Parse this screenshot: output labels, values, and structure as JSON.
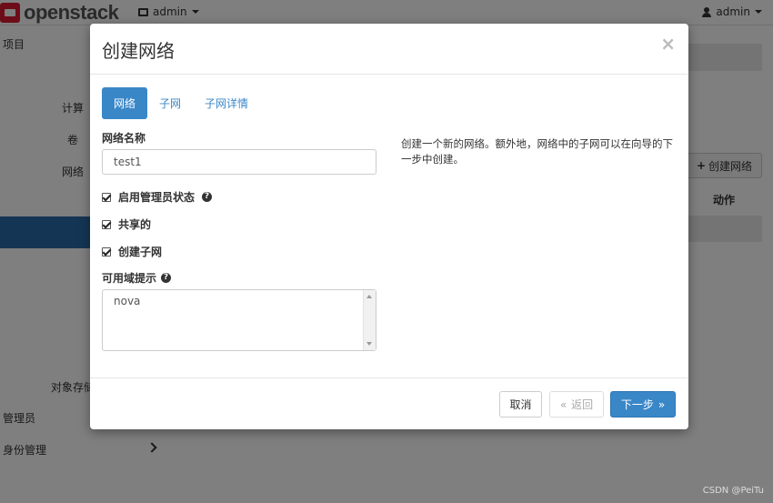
{
  "topbar": {
    "logo_text": "openstack",
    "project_label": "admin",
    "user_label": "admin"
  },
  "sidenav": {
    "project": "项目",
    "compute": "计算",
    "volume": "卷",
    "network": "网络",
    "object_store": "对象存储",
    "admin": "管理员",
    "identity": "身份管理"
  },
  "background": {
    "create_network_button": "创建网络",
    "actions_header": "动作"
  },
  "modal": {
    "title": "创建网络",
    "close_glyph": "×",
    "tabs": [
      {
        "label": "网络",
        "active": true
      },
      {
        "label": "子网",
        "active": false
      },
      {
        "label": "子网详情",
        "active": false
      }
    ],
    "network_name_label": "网络名称",
    "network_name_value": "test1",
    "checkboxes": [
      {
        "label": "启用管理员状态",
        "checked": true,
        "help": true
      },
      {
        "label": "共享的",
        "checked": true,
        "help": false
      },
      {
        "label": "创建子网",
        "checked": true,
        "help": false
      }
    ],
    "az_hint_label": "可用域提示",
    "az_hint_value": "nova",
    "help_text": "创建一个新的网络。额外地，网络中的子网可以在向导的下一步中创建。",
    "footer": {
      "cancel": "取消",
      "back": "返回",
      "back_glyph": "«",
      "next": "下一步",
      "next_glyph": "»"
    }
  },
  "watermark": "CSDN @PeiTu",
  "colors": {
    "primary": "#3a87c8",
    "sidebar_active": "#2b6aa8",
    "brand_red": "#da1a32"
  }
}
